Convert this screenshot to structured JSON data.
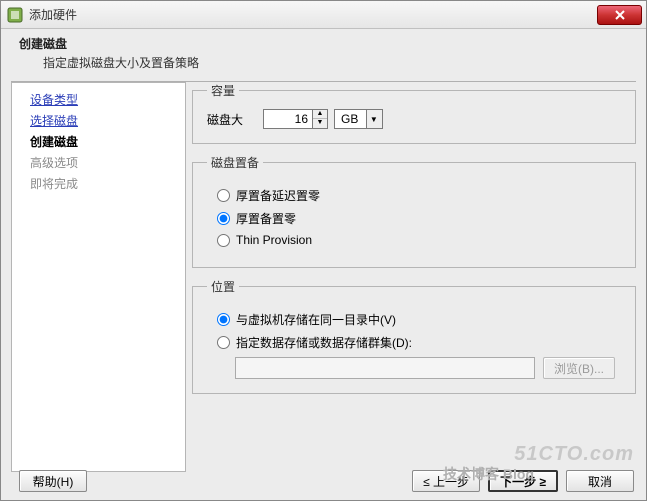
{
  "window": {
    "title": "添加硬件"
  },
  "header": {
    "title": "创建磁盘",
    "subtitle": "指定虚拟磁盘大小及置备策略"
  },
  "nav": {
    "items": [
      {
        "label": "设备类型",
        "state": "link"
      },
      {
        "label": "选择磁盘",
        "state": "link"
      },
      {
        "label": "创建磁盘",
        "state": "current"
      },
      {
        "label": "高级选项",
        "state": "disabled"
      },
      {
        "label": "即将完成",
        "state": "disabled"
      }
    ]
  },
  "capacity": {
    "legend": "容量",
    "label": "磁盘大",
    "value": "16",
    "unit": "GB"
  },
  "provision": {
    "legend": "磁盘置备",
    "options": [
      {
        "label": "厚置备延迟置零",
        "checked": false
      },
      {
        "label": "厚置备置零",
        "checked": true
      },
      {
        "label": "Thin Provision",
        "checked": false
      }
    ]
  },
  "location": {
    "legend": "位置",
    "options": [
      {
        "label": "与虚拟机存储在同一目录中(V)",
        "checked": true
      },
      {
        "label": "指定数据存储或数据存储群集(D):",
        "checked": false
      }
    ],
    "path": "",
    "browse": "浏览(B)..."
  },
  "footer": {
    "help": "帮助(H)",
    "back": "≤ 上一步",
    "next": "下一步 ≥",
    "cancel": "取消"
  },
  "watermark": {
    "brand": "51CTO.com",
    "sub": "技术博客  Blog"
  }
}
